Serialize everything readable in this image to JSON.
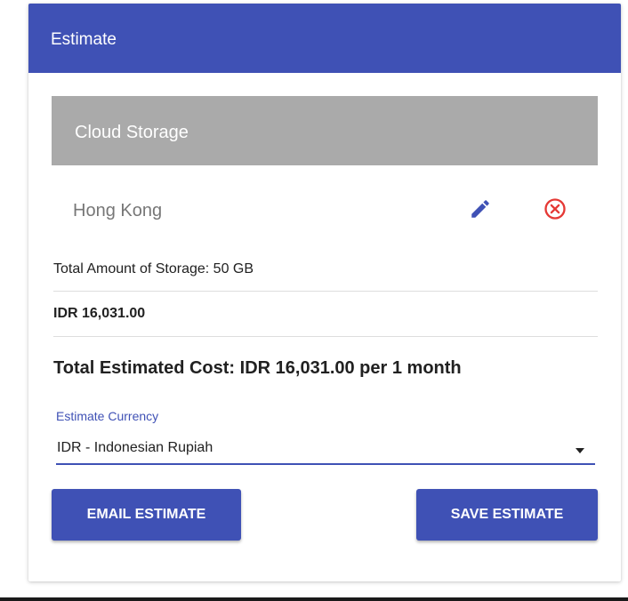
{
  "header": {
    "title": "Estimate"
  },
  "service": {
    "name": "Cloud Storage",
    "region": "Hong Kong",
    "detail": "Total Amount of Storage: 50 GB",
    "price": "IDR 16,031.00"
  },
  "total": {
    "text": "Total Estimated Cost: IDR 16,031.00 per 1 month"
  },
  "currency": {
    "label": "Estimate Currency",
    "selected": "IDR - Indonesian Rupiah"
  },
  "actions": {
    "email_label": "EMAIL ESTIMATE",
    "save_label": "SAVE ESTIMATE"
  },
  "icons": {
    "edit": "pencil-icon",
    "remove": "close-circle-icon"
  },
  "colors": {
    "primary": "#3f51b5",
    "service_header": "#aaaaaa",
    "remove": "#e53935"
  }
}
